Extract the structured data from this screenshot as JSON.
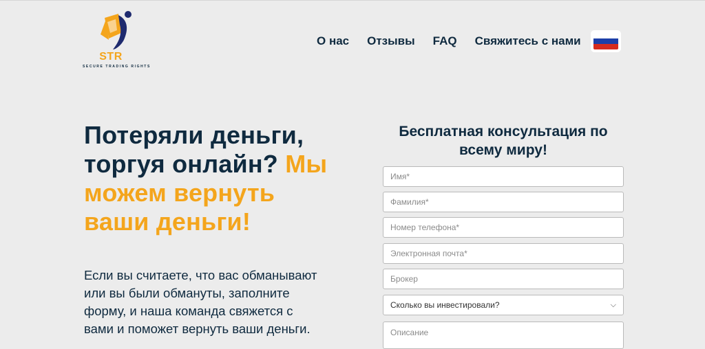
{
  "logo": {
    "name": "STR",
    "tagline": "SECURE TRADING RIGHTS",
    "colors": {
      "brand_navy": "#1e2a6e",
      "brand_gold": "#f4a51c"
    }
  },
  "nav": {
    "items": [
      {
        "label": "О нас"
      },
      {
        "label": "Отзывы"
      },
      {
        "label": "FAQ"
      },
      {
        "label": "Свяжитесь с нами"
      }
    ],
    "language_flag": "russia-flag-icon"
  },
  "hero": {
    "headline_dark": "Потеряли деньги, торгуя онлайн?",
    "headline_accent": "Мы можем вернуть ваши деньги!",
    "lead": "Если вы считаете, что вас обманывают или вы были обмануты, заполните форму, и наша команда свяжется с вами и поможет вернуть ваши деньги."
  },
  "form": {
    "title": "Бесплатная консультация по всему миру!",
    "first_name_placeholder": "Имя*",
    "last_name_placeholder": "Фамилия*",
    "phone_placeholder": "Номер телефона*",
    "email_placeholder": "Электронная почта*",
    "broker_placeholder": "Брокер",
    "invested_select_value": "Сколько вы инвестировали?",
    "description_placeholder": "Описание"
  },
  "colors": {
    "background": "#ececec",
    "text_dark": "#0f2a3f",
    "accent": "#f4a51c"
  }
}
